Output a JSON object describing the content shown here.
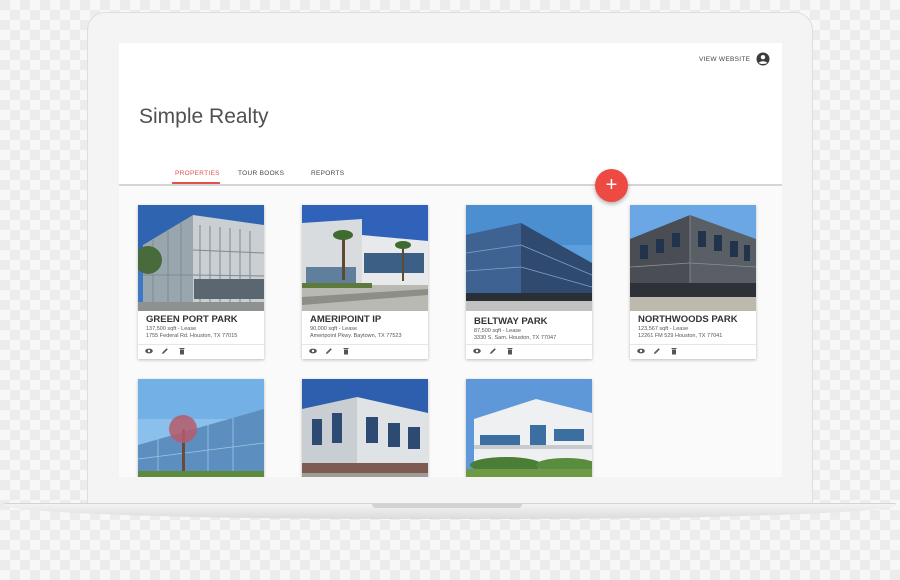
{
  "app": {
    "title": "Simple Realty"
  },
  "header": {
    "view_website_label": "VIEW WEBSITE",
    "account_icon": "account-circle-icon"
  },
  "tabs": [
    {
      "label": "PROPERTIES",
      "active": true
    },
    {
      "label": "TOUR BOOKS",
      "active": false
    },
    {
      "label": "REPORTS",
      "active": false
    }
  ],
  "fab": {
    "icon": "add-icon",
    "label": "+"
  },
  "colors": {
    "accent": "#ee4a44",
    "tab_active": "#e25050",
    "text": "#505050"
  },
  "properties": [
    {
      "name": "GREEN PORT PARK",
      "sqft": "137,500 sqft - Lease",
      "address": "1755 Federal Rd. Houston, TX 77015"
    },
    {
      "name": "AMERIPOINT IP",
      "sqft": "90,000 sqft - Lease",
      "address": "Ameripoint Pkwy. Baytown, TX 77523"
    },
    {
      "name": "BELTWAY PARK",
      "sqft": "87,500 sqft - Lease",
      "address": "3330 S. Sam. Houston, TX 77047"
    },
    {
      "name": "NORTHWOODS PARK",
      "sqft": "123,567 sqft - Lease",
      "address": "12261 FM 529 Houston, TX 77041"
    },
    {
      "name": "",
      "sqft": "",
      "address": ""
    },
    {
      "name": "",
      "sqft": "",
      "address": ""
    },
    {
      "name": "",
      "sqft": "",
      "address": ""
    }
  ],
  "card_actions": [
    "view-icon",
    "edit-icon",
    "delete-icon"
  ]
}
